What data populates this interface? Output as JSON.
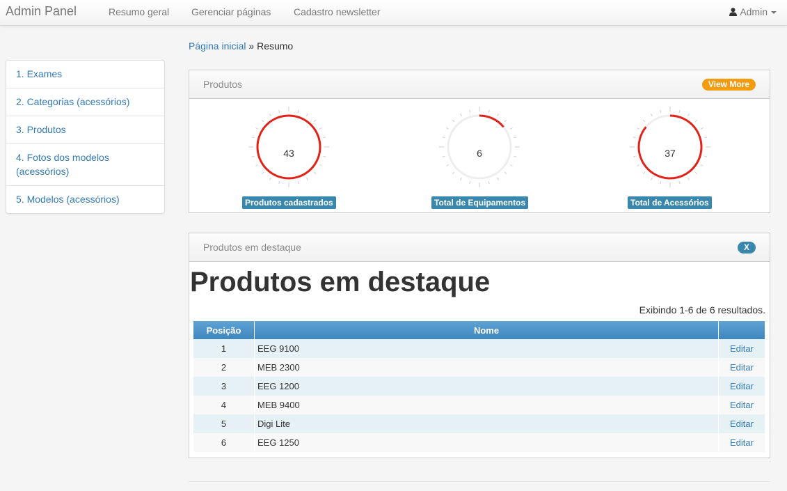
{
  "navbar": {
    "brand": "Admin Panel",
    "links": [
      "Resumo geral",
      "Gerenciar páginas",
      "Cadastro newsletter"
    ],
    "user": "Admin"
  },
  "sidebar": {
    "items": [
      {
        "label": "1. Exames"
      },
      {
        "label": "2. Categorias (acessórios)"
      },
      {
        "label": "3. Produtos"
      },
      {
        "label": "4. Fotos dos modelos (acessórios)"
      },
      {
        "label": "5. Modelos (acessórios)"
      }
    ]
  },
  "breadcrumb": {
    "home": "Página inicial",
    "separator": "»",
    "current": "Resumo"
  },
  "produtos_panel": {
    "title": "Produtos",
    "view_more": "View More",
    "gauges": [
      {
        "value": "43",
        "label": "Produtos cadastrados",
        "fill_fraction": 1.0
      },
      {
        "value": "6",
        "label": "Total de Equipamentos",
        "fill_fraction": 0.14
      },
      {
        "value": "37",
        "label": "Total de Acessórios",
        "fill_fraction": 0.86
      }
    ],
    "gauge_color": "#e2231a"
  },
  "destaque_panel": {
    "title": "Produtos em destaque",
    "close_label": "X",
    "heading": "Produtos em destaque",
    "summary": "Exibindo 1-6 de 6 resultados.",
    "columns": [
      "Posição",
      "Nome",
      ""
    ],
    "edit_label": "Editar",
    "rows": [
      {
        "pos": "1",
        "name": "EEG 9100"
      },
      {
        "pos": "2",
        "name": "MEB 2300"
      },
      {
        "pos": "3",
        "name": "EEG 1200"
      },
      {
        "pos": "4",
        "name": "MEB 9400"
      },
      {
        "pos": "5",
        "name": "Digi Lite"
      },
      {
        "pos": "6",
        "name": "EEG 1250"
      }
    ]
  }
}
